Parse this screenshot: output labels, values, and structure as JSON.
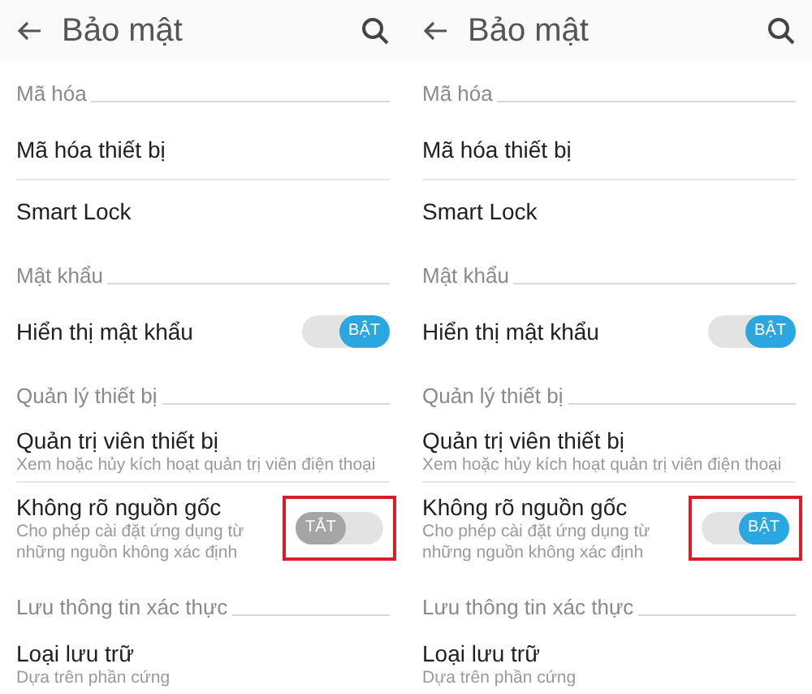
{
  "panels": [
    {
      "title": "Bảo mật",
      "items": [
        {
          "kind": "section",
          "title": "Mã hóa"
        },
        {
          "kind": "item",
          "title": "Mã hóa thiết bị"
        },
        {
          "kind": "item",
          "title": "Smart Lock"
        },
        {
          "kind": "section",
          "title": "Mật khẩu"
        },
        {
          "kind": "switch",
          "title": "Hiển thị mật khẩu",
          "on": true,
          "switch_label": "BẬT",
          "highlighted": false
        },
        {
          "kind": "section",
          "title": "Quản lý thiết bị"
        },
        {
          "kind": "item",
          "title": "Quản trị viên thiết bị",
          "subtitle": "Xem hoặc hủy kích hoạt quản trị viên điện thoại"
        },
        {
          "kind": "switch",
          "title": "Không rõ nguồn gốc",
          "subtitle": "Cho phép cài đặt ứng dụng từ những nguồn không xác định",
          "on": false,
          "switch_label": "TẮT",
          "highlighted": true
        },
        {
          "kind": "section",
          "title": "Lưu thông tin xác thực"
        },
        {
          "kind": "item",
          "title": "Loại lưu trữ",
          "subtitle": "Dựa trên phần cứng"
        }
      ]
    },
    {
      "title": "Bảo mật",
      "items": [
        {
          "kind": "section",
          "title": "Mã hóa"
        },
        {
          "kind": "item",
          "title": "Mã hóa thiết bị"
        },
        {
          "kind": "item",
          "title": "Smart Lock"
        },
        {
          "kind": "section",
          "title": "Mật khẩu"
        },
        {
          "kind": "switch",
          "title": "Hiển thị mật khẩu",
          "on": true,
          "switch_label": "BẬT",
          "highlighted": false
        },
        {
          "kind": "section",
          "title": "Quản lý thiết bị"
        },
        {
          "kind": "item",
          "title": "Quản trị viên thiết bị",
          "subtitle": "Xem hoặc hủy kích hoạt quản trị viên điện thoại"
        },
        {
          "kind": "switch",
          "title": "Không rõ nguồn gốc",
          "subtitle": "Cho phép cài đặt ứng dụng từ những nguồn không xác định",
          "on": true,
          "switch_label": "BẬT",
          "highlighted": true
        },
        {
          "kind": "section",
          "title": "Lưu thông tin xác thực"
        },
        {
          "kind": "item",
          "title": "Loại lưu trữ",
          "subtitle": "Dựa trên phần cứng"
        }
      ]
    }
  ]
}
